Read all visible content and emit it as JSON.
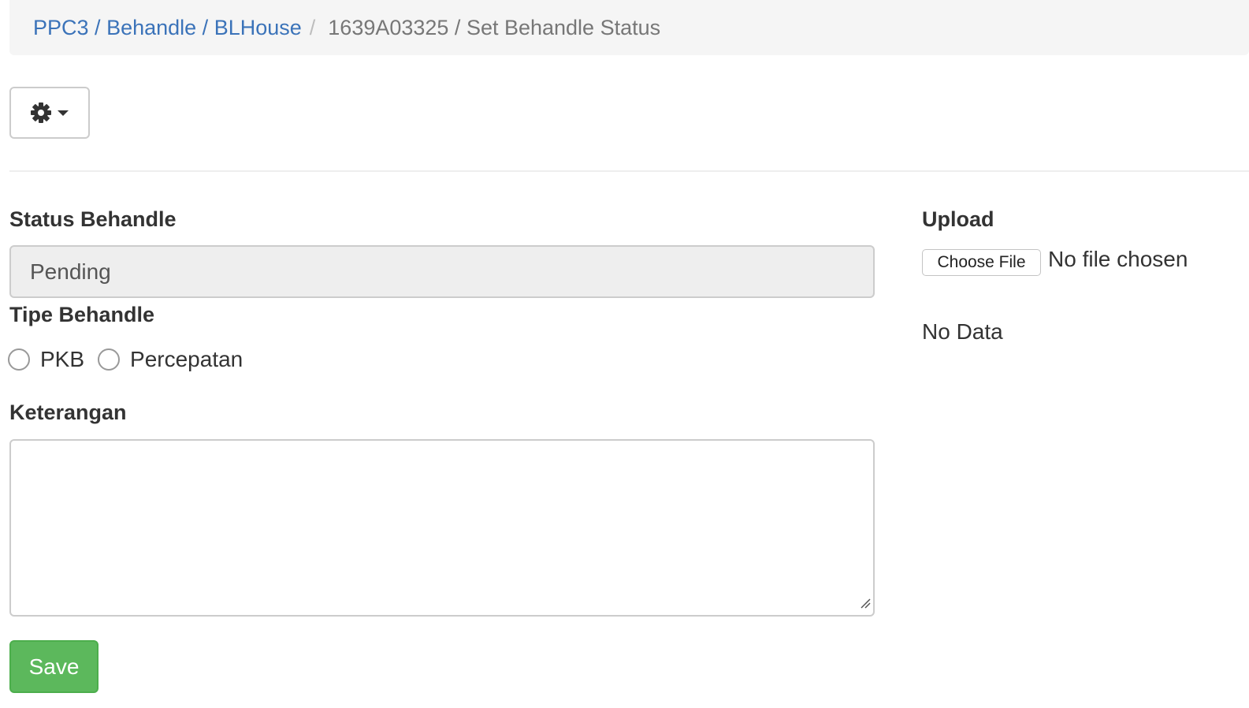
{
  "breadcrumb": {
    "links": [
      "PPC3",
      "Behandle",
      "BLHouse"
    ],
    "link_separator": " / ",
    "separator": "/",
    "current": "1639A03325 / Set Behandle Status"
  },
  "toolbar": {
    "settings_icon": "gear-icon",
    "dropdown_icon": "caret-down-icon"
  },
  "form": {
    "status_label": "Status Behandle",
    "status_value": "Pending",
    "type_label": "Tipe Behandle",
    "type_options": [
      "PKB",
      "Percepatan"
    ],
    "type_selected": null,
    "notes_label": "Keterangan",
    "notes_value": "",
    "save_label": "Save",
    "save_color": "#5cb85c"
  },
  "upload": {
    "label": "Upload",
    "choose_file_label": "Choose File",
    "file_status": "No file chosen",
    "empty_text": "No Data"
  },
  "colors": {
    "link": "#3b73b9",
    "breadcrumb_bg": "#f5f5f5",
    "readonly_bg": "#eeeeee"
  }
}
